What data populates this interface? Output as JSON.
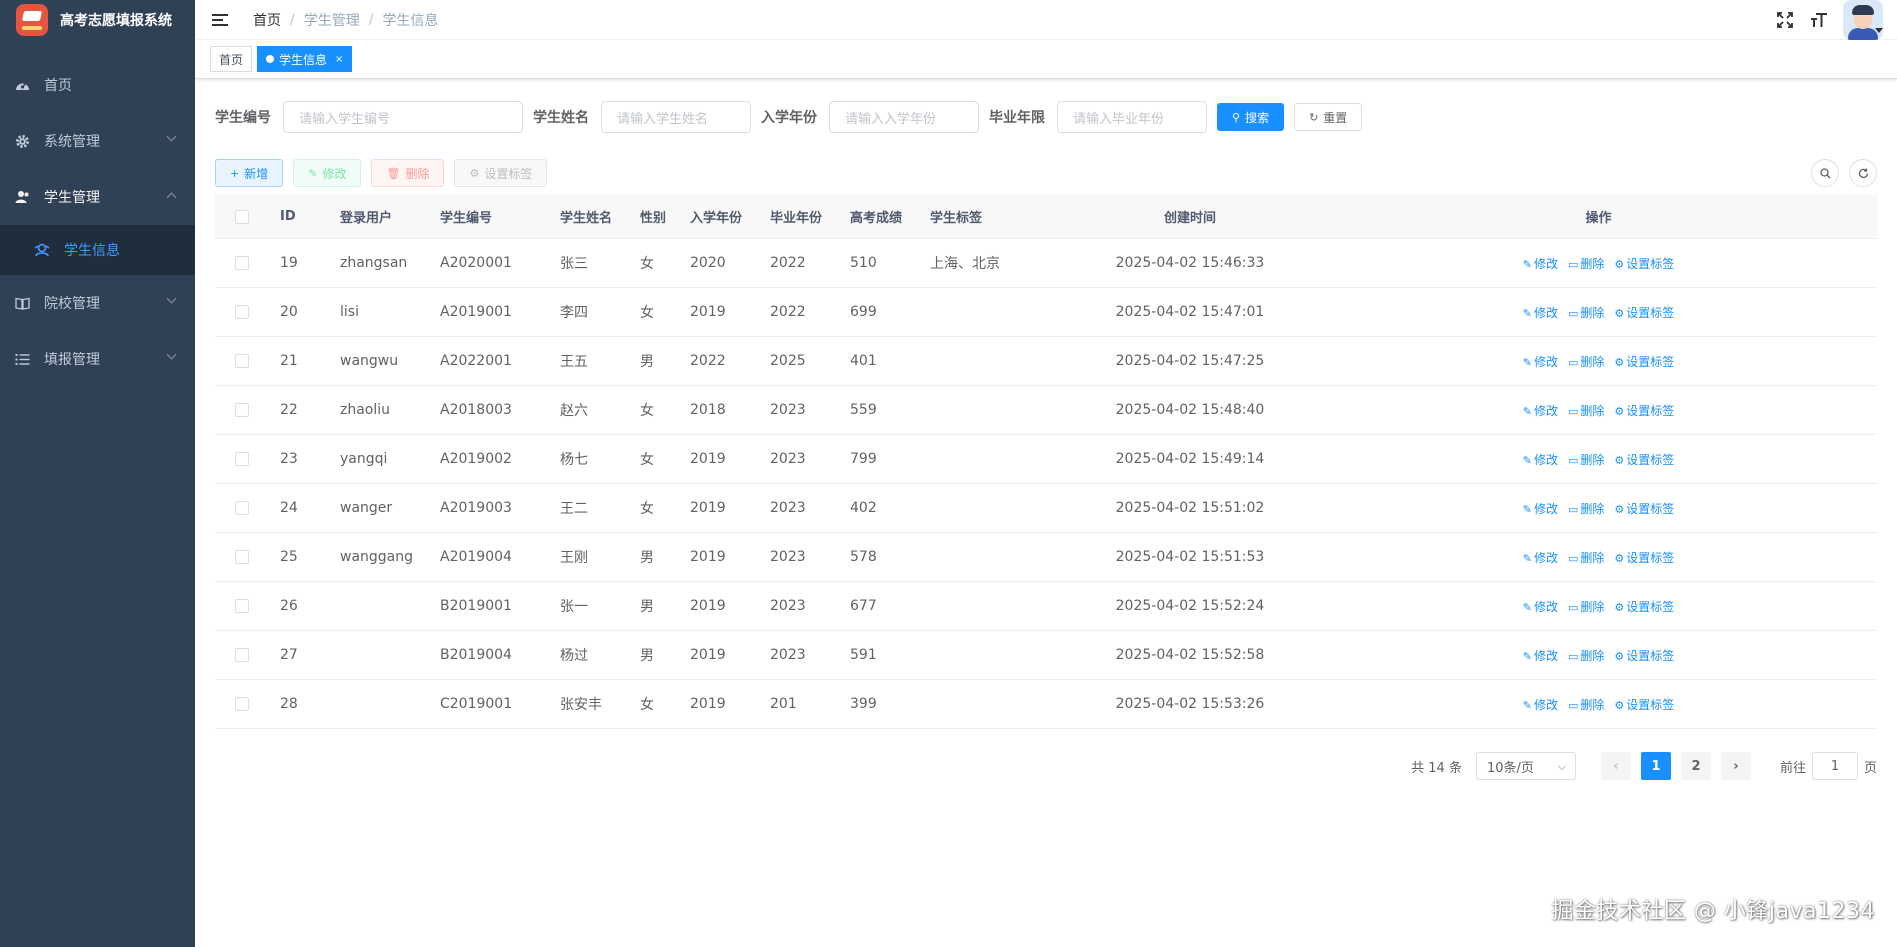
{
  "app": {
    "title": "高考志愿填报系统"
  },
  "sidebar": {
    "items": [
      {
        "label": "首页"
      },
      {
        "label": "系统管理"
      },
      {
        "label": "学生管理"
      },
      {
        "label": "学生信息"
      },
      {
        "label": "院校管理"
      },
      {
        "label": "填报管理"
      }
    ]
  },
  "breadcrumb": [
    "首页",
    "学生管理",
    "学生信息"
  ],
  "tags": {
    "home": "首页",
    "current": "学生信息",
    "close": "×"
  },
  "search": {
    "no_label": "学生编号",
    "no_placeholder": "请输入学生编号",
    "name_label": "学生姓名",
    "name_placeholder": "请输入学生姓名",
    "in_label": "入学年份",
    "in_placeholder": "请输入入学年份",
    "out_label": "毕业年限",
    "out_placeholder": "请输入毕业年份",
    "search_btn": "搜索",
    "reset_btn": "重置"
  },
  "toolbar": {
    "add": "新增",
    "edit": "修改",
    "delete": "删除",
    "set_tag": "设置标签"
  },
  "table": {
    "headers": [
      "ID",
      "登录用户",
      "学生编号",
      "学生姓名",
      "性别",
      "入学年份",
      "毕业年份",
      "高考成绩",
      "学生标签",
      "创建时间",
      "操作"
    ],
    "rows": [
      {
        "id": "19",
        "user": "zhangsan",
        "no": "A2020001",
        "name": "张三",
        "sex": "女",
        "in": "2020",
        "out": "2022",
        "score": "510",
        "tag": "上海、北京",
        "time": "2025-04-02 15:46:33"
      },
      {
        "id": "20",
        "user": "lisi",
        "no": "A2019001",
        "name": "李四",
        "sex": "女",
        "in": "2019",
        "out": "2022",
        "score": "699",
        "tag": "",
        "time": "2025-04-02 15:47:01"
      },
      {
        "id": "21",
        "user": "wangwu",
        "no": "A2022001",
        "name": "王五",
        "sex": "男",
        "in": "2022",
        "out": "2025",
        "score": "401",
        "tag": "",
        "time": "2025-04-02 15:47:25"
      },
      {
        "id": "22",
        "user": "zhaoliu",
        "no": "A2018003",
        "name": "赵六",
        "sex": "女",
        "in": "2018",
        "out": "2023",
        "score": "559",
        "tag": "",
        "time": "2025-04-02 15:48:40"
      },
      {
        "id": "23",
        "user": "yangqi",
        "no": "A2019002",
        "name": "杨七",
        "sex": "女",
        "in": "2019",
        "out": "2023",
        "score": "799",
        "tag": "",
        "time": "2025-04-02 15:49:14"
      },
      {
        "id": "24",
        "user": "wanger",
        "no": "A2019003",
        "name": "王二",
        "sex": "女",
        "in": "2019",
        "out": "2023",
        "score": "402",
        "tag": "",
        "time": "2025-04-02 15:51:02"
      },
      {
        "id": "25",
        "user": "wanggang",
        "no": "A2019004",
        "name": "王刚",
        "sex": "男",
        "in": "2019",
        "out": "2023",
        "score": "578",
        "tag": "",
        "time": "2025-04-02 15:51:53"
      },
      {
        "id": "26",
        "user": "",
        "no": "B2019001",
        "name": "张一",
        "sex": "男",
        "in": "2019",
        "out": "2023",
        "score": "677",
        "tag": "",
        "time": "2025-04-02 15:52:24"
      },
      {
        "id": "27",
        "user": "",
        "no": "B2019004",
        "name": "杨过",
        "sex": "男",
        "in": "2019",
        "out": "2023",
        "score": "591",
        "tag": "",
        "time": "2025-04-02 15:52:58"
      },
      {
        "id": "28",
        "user": "",
        "no": "C2019001",
        "name": "张安丰",
        "sex": "女",
        "in": "2019",
        "out": "201",
        "score": "399",
        "tag": "",
        "time": "2025-04-02 15:53:26"
      }
    ],
    "ops": {
      "edit": "修改",
      "delete": "删除",
      "set_tag": "设置标签"
    }
  },
  "pagination": {
    "total": "共 14 条",
    "page_size": "10条/页",
    "pages": [
      "1",
      "2"
    ],
    "current_page": "1",
    "goto_label": "前往",
    "goto_value": "1",
    "page_unit": "页"
  },
  "watermark": "掘金技术社区 @ 小锋java1234",
  "colors": {
    "sidebar_bg": "#304156",
    "primary": "#1890ff"
  }
}
